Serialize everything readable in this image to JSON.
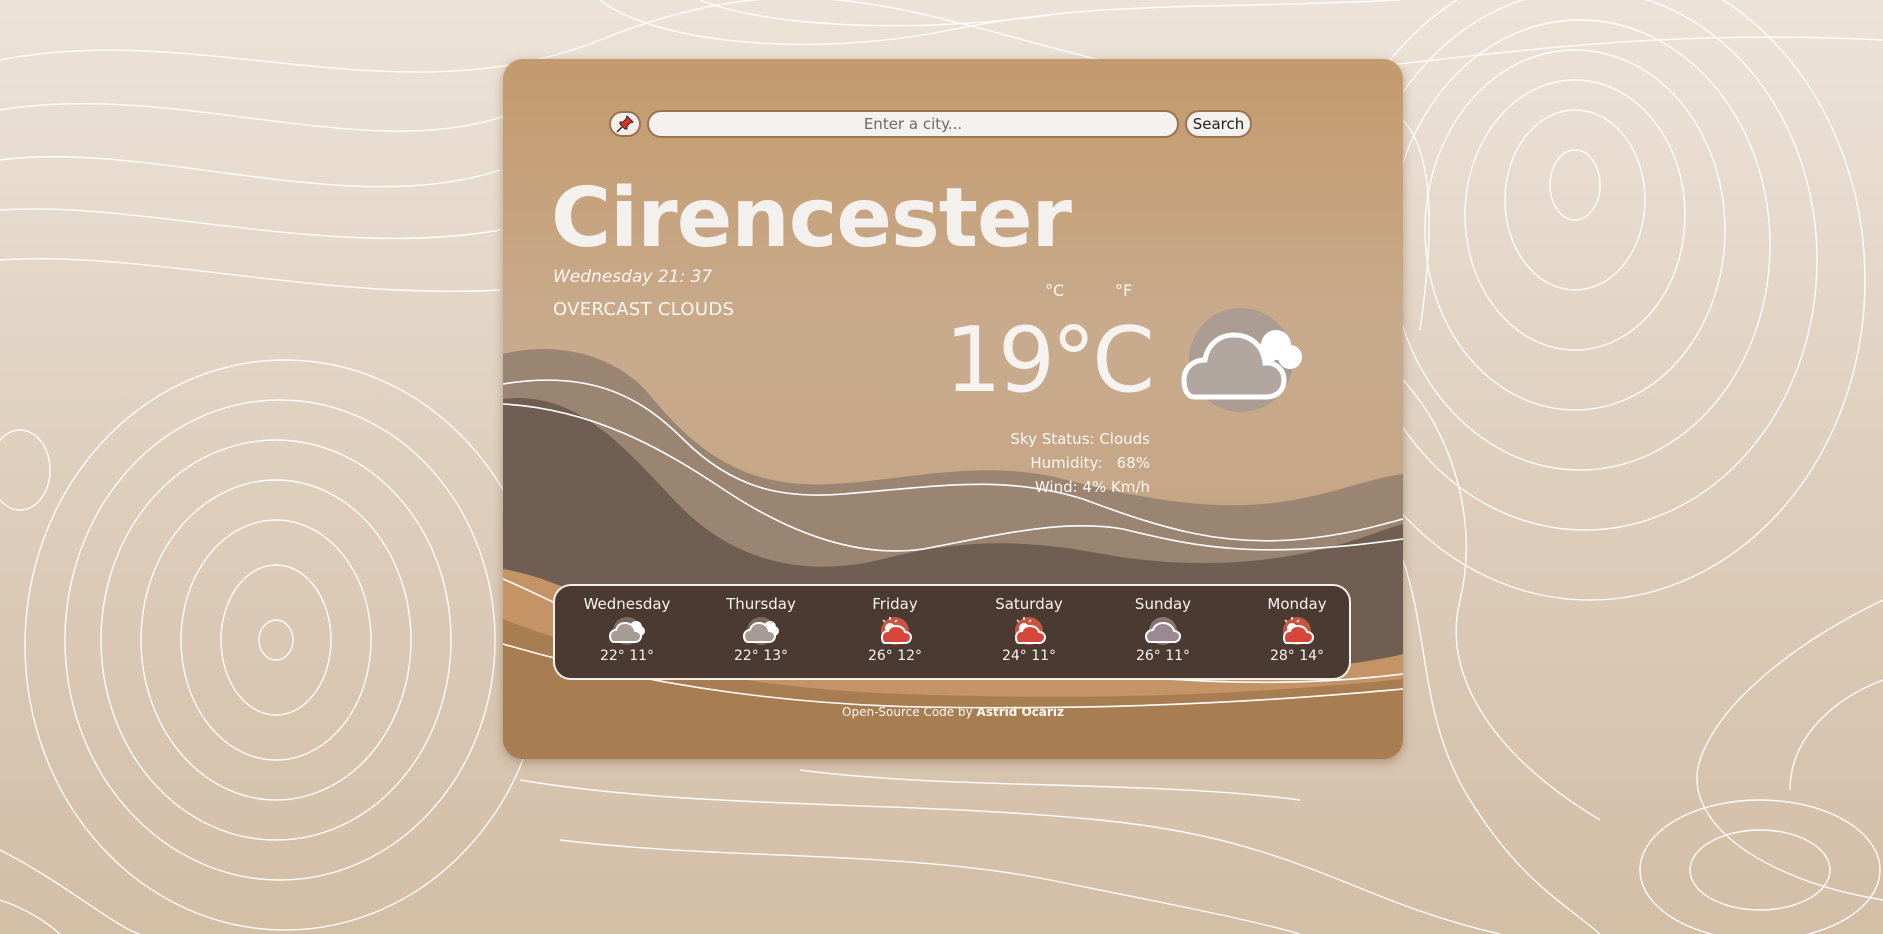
{
  "search": {
    "placeholder": "Enter a city...",
    "button_label": "Search"
  },
  "location": {
    "city": "Cirencester",
    "datetime": "Wednesday 21: 37",
    "description": "OVERCAST CLOUDS"
  },
  "units": {
    "celsius": "°C",
    "fahrenheit": "°F"
  },
  "current": {
    "temperature": "19°C",
    "icon": "cloud-icon",
    "sky_status": "Sky Status: Clouds",
    "humidity": "Humidity:   68%",
    "wind": "Wind: 4% Km/h"
  },
  "forecast": [
    {
      "day": "Wednesday",
      "temps": "22° 11°",
      "icon": "cloud-icon"
    },
    {
      "day": "Thursday",
      "temps": "22° 13°",
      "icon": "cloud-icon"
    },
    {
      "day": "Friday",
      "temps": "26° 12°",
      "icon": "sun-cloud-icon"
    },
    {
      "day": "Saturday",
      "temps": "24° 11°",
      "icon": "sun-cloud-icon"
    },
    {
      "day": "Sunday",
      "temps": "26° 11°",
      "icon": "cloud-icon"
    },
    {
      "day": "Monday",
      "temps": "28° 14°",
      "icon": "sun-cloud-icon"
    }
  ],
  "footer": {
    "text": "Open-Source Code by ",
    "author": "Astrid Ocariz"
  },
  "colors": {
    "card_top": "#c49a6d",
    "card_bottom": "#b9936b",
    "forecast_bg": "#4a3a31",
    "text": "#fbf7f2"
  }
}
